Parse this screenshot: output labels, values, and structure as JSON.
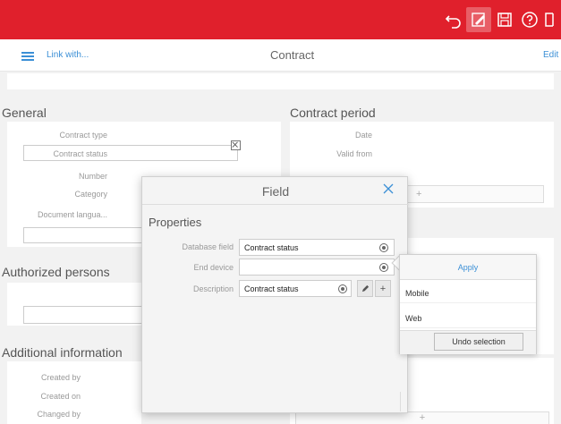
{
  "header": {
    "link_with": "Link with...",
    "title": "Contract",
    "edit": "Edit"
  },
  "general": {
    "title": "General",
    "labels": {
      "contract_type": "Contract type",
      "contract_status": "Contract status",
      "number": "Number",
      "category": "Category",
      "document_language": "Document langua..."
    }
  },
  "contract_period": {
    "title": "Contract period",
    "labels": {
      "date": "Date",
      "valid_from": "Valid from"
    },
    "add": "+"
  },
  "authorized_persons": {
    "title": "Authorized persons"
  },
  "additional_information": {
    "title": "Additional information",
    "labels": {
      "created_by": "Created by",
      "created_on": "Created on",
      "changed_by": "Changed by"
    },
    "add": "+"
  },
  "modal": {
    "title": "Field",
    "properties_title": "Properties",
    "database_field_label": "Database field",
    "database_field_value": "Contract status",
    "end_device_label": "End device",
    "end_device_value": "",
    "description_label": "Description",
    "description_value": "Contract status",
    "add_glyph": "+"
  },
  "dropdown": {
    "apply": "Apply",
    "options": [
      "Mobile",
      "Web"
    ],
    "undo": "Undo selection"
  },
  "colors": {
    "brand_red": "#e0202c",
    "link_blue": "#3b8fd6"
  }
}
